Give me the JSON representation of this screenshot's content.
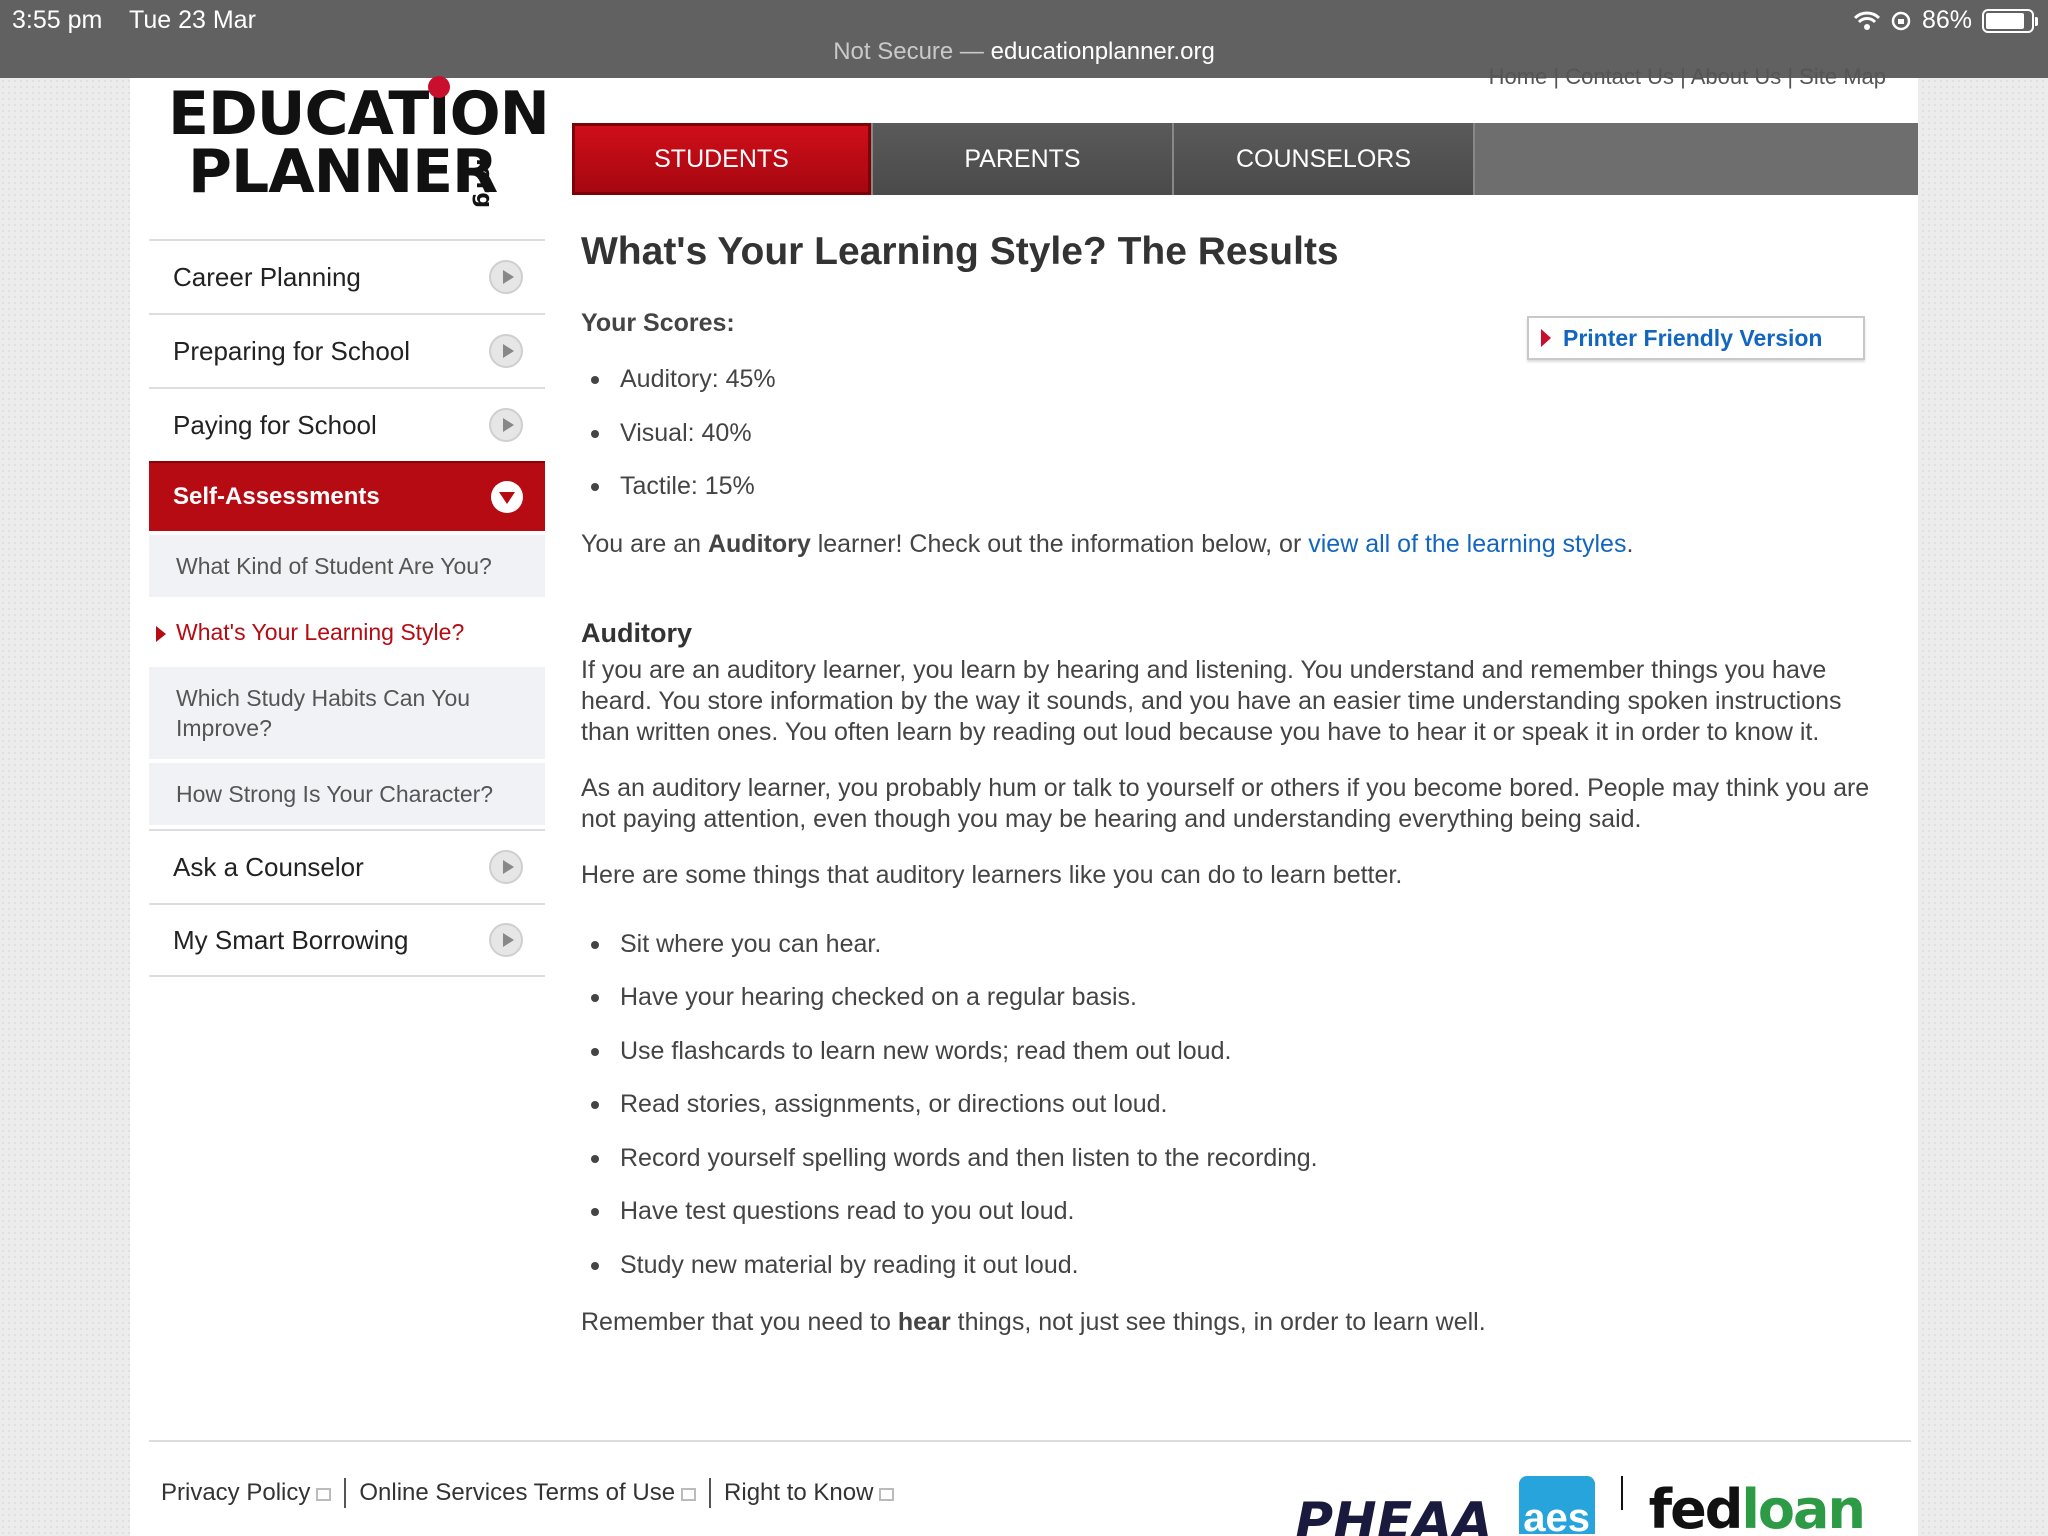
{
  "status_bar": {
    "time": "3:55 pm",
    "date": "Tue 23 Mar",
    "battery": "86%",
    "url_prefix": "Not Secure —",
    "url_domain": "educationplanner.org"
  },
  "header": {
    "logo_line1": "EDUCATION",
    "logo_line2": "PLANNER",
    "logo_suffix": ".org",
    "top_links": "Home | Contact Us | About Us | Site Map"
  },
  "tabs": [
    {
      "label": "STUDENTS"
    },
    {
      "label": "PARENTS"
    },
    {
      "label": "COUNSELORS"
    }
  ],
  "sidebar": {
    "items_top": [
      {
        "label": "Career Planning"
      },
      {
        "label": "Preparing for School"
      },
      {
        "label": "Paying for School"
      }
    ],
    "active": "Self-Assessments",
    "sub_items": [
      {
        "label": "What Kind of Student Are You?"
      },
      {
        "label": "What's Your Learning Style?"
      },
      {
        "label": "Which Study Habits Can You Improve?"
      },
      {
        "label": "How Strong Is Your Character?"
      }
    ],
    "items_bottom": [
      {
        "label": "Ask a Counselor"
      },
      {
        "label": "My Smart Borrowing"
      }
    ]
  },
  "main": {
    "title": "What's Your Learning Style? The Results",
    "scores_label": "Your Scores:",
    "printer_label": "Printer Friendly Version",
    "scores": [
      {
        "label": "Auditory: 45%"
      },
      {
        "label": "Visual: 40%"
      },
      {
        "label": "Tactile: 15%"
      }
    ],
    "result_pre": "You are an ",
    "result_style": "Auditory",
    "result_mid": " learner! Check out the information below, or ",
    "result_link": "view all of the learning styles",
    "result_post": ".",
    "section_heading": "Auditory",
    "para1": "If you are an auditory learner, you learn by hearing and listening. You understand and remember things you have heard. You store information by the way it sounds, and you have an easier time understanding spoken instructions than written ones. You often learn by reading out loud because you have to hear it or speak it in order to know it.",
    "para2": "As an auditory learner, you probably hum or talk to yourself or others if you become bored. People may think you are not paying attention, even though you may be hearing and understanding everything being said.",
    "para3": "Here are some things that auditory learners like you can do to learn better.",
    "tips": [
      {
        "label": "Sit where you can hear."
      },
      {
        "label": "Have your hearing checked on a regular basis."
      },
      {
        "label": "Use flashcards to learn new words; read them out loud."
      },
      {
        "label": "Read stories, assignments, or directions out loud."
      },
      {
        "label": "Record yourself spelling words and then listen to the recording."
      },
      {
        "label": "Have test questions read to you out loud."
      },
      {
        "label": "Study new material by reading it out loud."
      }
    ],
    "closing_pre": "Remember that you need to ",
    "closing_bold": "hear",
    "closing_post": " things, not just see things, in order to learn well."
  },
  "footer": {
    "links": [
      {
        "label": "Privacy Policy"
      },
      {
        "label": "Online Services Terms of Use"
      },
      {
        "label": "Right to Know"
      }
    ],
    "logo_pheaa": "PHEAA",
    "logo_aes": "aes",
    "logo_fed": "fed",
    "logo_loan": "loan"
  }
}
